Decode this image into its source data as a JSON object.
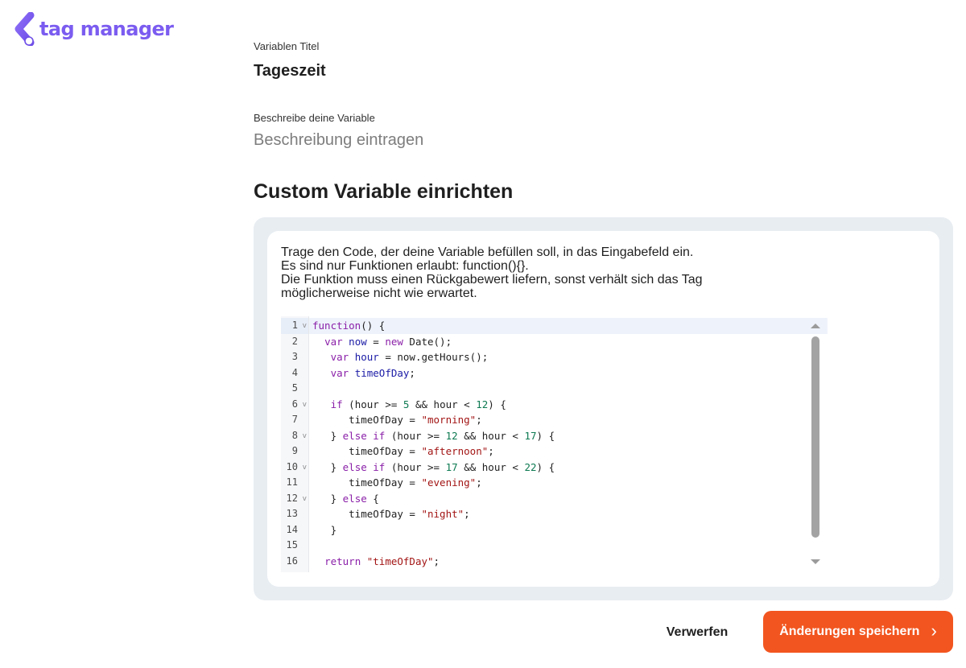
{
  "logo": {
    "text": "tag manager"
  },
  "form": {
    "title_label": "Variablen Titel",
    "title_value": "Tageszeit",
    "description_label": "Beschreibe deine Variable",
    "description_placeholder": "Beschreibung eintragen"
  },
  "section": {
    "title": "Custom Variable einrichten"
  },
  "instructions": [
    "Trage den Code, der deine Variable befüllen soll, in das Eingabefeld ein.",
    "Es sind nur Funktionen erlaubt: function(){}.",
    "Die Funktion muss einen Rückgabewert liefern, sonst verhält sich das Tag",
    "möglicherweise nicht wie erwartet."
  ],
  "editor": {
    "active_line": 1,
    "foldable_lines": [
      1,
      6,
      8,
      10,
      12
    ],
    "lines": [
      [
        {
          "t": "function",
          "c": "kw"
        },
        {
          "t": "() {"
        }
      ],
      [
        {
          "t": "  "
        },
        {
          "t": "var",
          "c": "kw"
        },
        {
          "t": " "
        },
        {
          "t": "now",
          "c": "var"
        },
        {
          "t": " = "
        },
        {
          "t": "new",
          "c": "kw"
        },
        {
          "t": " Date();"
        }
      ],
      [
        {
          "t": "   "
        },
        {
          "t": "var",
          "c": "kw"
        },
        {
          "t": " "
        },
        {
          "t": "hour",
          "c": "var"
        },
        {
          "t": " = now.getHours();"
        }
      ],
      [
        {
          "t": "   "
        },
        {
          "t": "var",
          "c": "kw"
        },
        {
          "t": " "
        },
        {
          "t": "timeOfDay",
          "c": "var"
        },
        {
          "t": ";"
        }
      ],
      [
        {
          "t": ""
        }
      ],
      [
        {
          "t": "   "
        },
        {
          "t": "if",
          "c": "kw"
        },
        {
          "t": " (hour >= "
        },
        {
          "t": "5",
          "c": "num"
        },
        {
          "t": " && hour < "
        },
        {
          "t": "12",
          "c": "num"
        },
        {
          "t": ") {"
        }
      ],
      [
        {
          "t": "      timeOfDay = "
        },
        {
          "t": "\"morning\"",
          "c": "str"
        },
        {
          "t": ";"
        }
      ],
      [
        {
          "t": "   } "
        },
        {
          "t": "else",
          "c": "kw"
        },
        {
          "t": " "
        },
        {
          "t": "if",
          "c": "kw"
        },
        {
          "t": " (hour >= "
        },
        {
          "t": "12",
          "c": "num"
        },
        {
          "t": " && hour < "
        },
        {
          "t": "17",
          "c": "num"
        },
        {
          "t": ") {"
        }
      ],
      [
        {
          "t": "      timeOfDay = "
        },
        {
          "t": "\"afternoon\"",
          "c": "str"
        },
        {
          "t": ";"
        }
      ],
      [
        {
          "t": "   } "
        },
        {
          "t": "else",
          "c": "kw"
        },
        {
          "t": " "
        },
        {
          "t": "if",
          "c": "kw"
        },
        {
          "t": " (hour >= "
        },
        {
          "t": "17",
          "c": "num"
        },
        {
          "t": " && hour < "
        },
        {
          "t": "22",
          "c": "num"
        },
        {
          "t": ") {"
        }
      ],
      [
        {
          "t": "      timeOfDay = "
        },
        {
          "t": "\"evening\"",
          "c": "str"
        },
        {
          "t": ";"
        }
      ],
      [
        {
          "t": "   } "
        },
        {
          "t": "else",
          "c": "kw"
        },
        {
          "t": " {"
        }
      ],
      [
        {
          "t": "      timeOfDay = "
        },
        {
          "t": "\"night\"",
          "c": "str"
        },
        {
          "t": ";"
        }
      ],
      [
        {
          "t": "   }"
        }
      ],
      [
        {
          "t": ""
        }
      ],
      [
        {
          "t": "  "
        },
        {
          "t": "return",
          "c": "kw"
        },
        {
          "t": " "
        },
        {
          "t": "\"timeOfDay\"",
          "c": "str"
        },
        {
          "t": ";"
        }
      ]
    ]
  },
  "buttons": {
    "discard_label": "Verwerfen",
    "save_label": "Änderungen speichern"
  },
  "colors": {
    "brand": "#7b5cf0",
    "primary_button": "#f2551f",
    "panel_bg": "#e8edf2"
  },
  "icons": {
    "logo": "chevron-left-logo-icon",
    "save_chevron": "chevron-right-icon",
    "fold": "chevron-down-icon"
  }
}
